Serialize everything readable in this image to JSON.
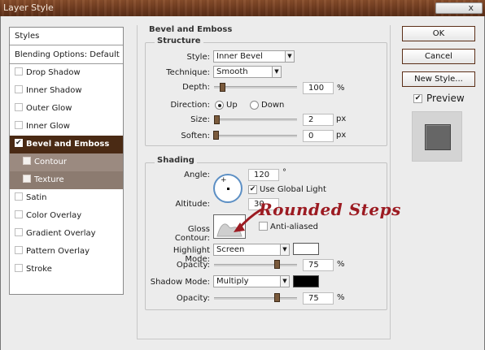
{
  "window": {
    "title": "Layer Style",
    "close_label": "x"
  },
  "styles_list": {
    "header": "Styles",
    "blending": "Blending Options: Default",
    "items": [
      {
        "label": "Drop Shadow",
        "checked": false
      },
      {
        "label": "Inner Shadow",
        "checked": false
      },
      {
        "label": "Outer Glow",
        "checked": false
      },
      {
        "label": "Inner Glow",
        "checked": false
      },
      {
        "label": "Bevel and Emboss",
        "checked": true
      },
      {
        "label": "Contour",
        "checked": false
      },
      {
        "label": "Texture",
        "checked": false
      },
      {
        "label": "Satin",
        "checked": false
      },
      {
        "label": "Color Overlay",
        "checked": false
      },
      {
        "label": "Gradient Overlay",
        "checked": false
      },
      {
        "label": "Pattern Overlay",
        "checked": false
      },
      {
        "label": "Stroke",
        "checked": false
      }
    ]
  },
  "bevel": {
    "section_title": "Bevel and Emboss",
    "structure_title": "Structure",
    "style_label": "Style:",
    "style_value": "Inner Bevel",
    "technique_label": "Technique:",
    "technique_value": "Smooth",
    "depth_label": "Depth:",
    "depth_value": "100",
    "depth_unit": "%",
    "direction_label": "Direction:",
    "direction_up": "Up",
    "direction_down": "Down",
    "size_label": "Size:",
    "size_value": "2",
    "size_unit": "px",
    "soften_label": "Soften:",
    "soften_value": "0",
    "soften_unit": "px"
  },
  "shading": {
    "title": "Shading",
    "angle_label": "Angle:",
    "angle_value": "120",
    "angle_unit": "°",
    "use_global_light": "Use Global Light",
    "altitude_label": "Altitude:",
    "altitude_value": "30",
    "gloss_contour_label": "Gloss Contour:",
    "anti_aliased": "Anti-aliased",
    "highlight_mode_label": "Highlight Mode:",
    "highlight_mode_value": "Screen",
    "highlight_opacity_label": "Opacity:",
    "highlight_opacity_value": "75",
    "highlight_opacity_unit": "%",
    "shadow_mode_label": "Shadow Mode:",
    "shadow_mode_value": "Multiply",
    "shadow_opacity_label": "Opacity:",
    "shadow_opacity_value": "75",
    "shadow_opacity_unit": "%",
    "highlight_color": "#ffffff",
    "shadow_color": "#000000"
  },
  "annotation": "Rounded Steps",
  "buttons": {
    "ok": "OK",
    "cancel": "Cancel",
    "new_style": "New Style...",
    "preview": "Preview"
  },
  "colors": {
    "accent": "#5b2f18",
    "selected_bg": "#4a2a14",
    "annotation": "#9c1b22"
  }
}
